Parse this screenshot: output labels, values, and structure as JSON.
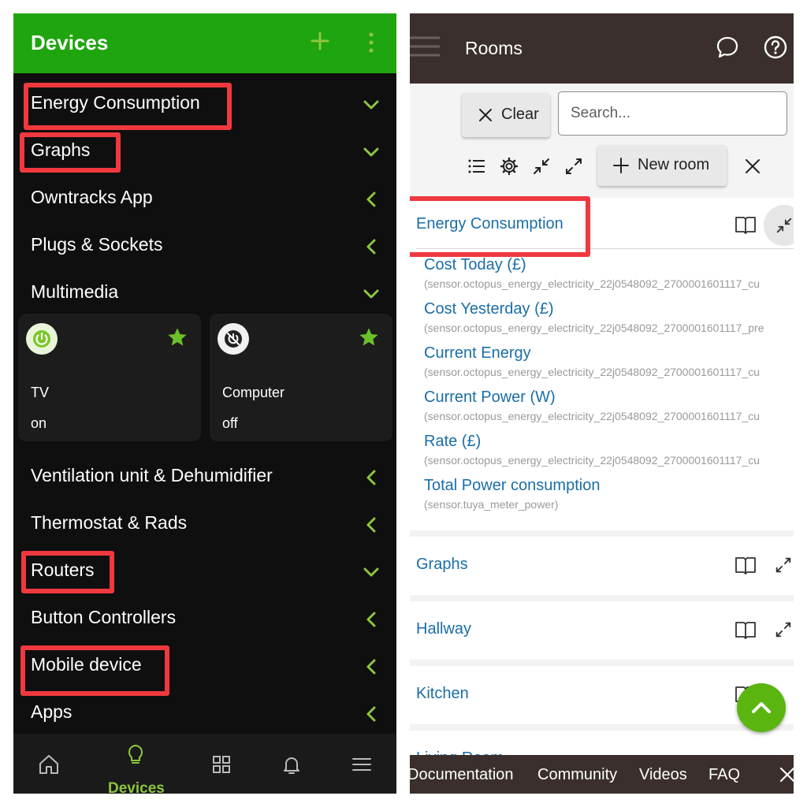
{
  "left": {
    "header": {
      "title": "Devices"
    },
    "rows": [
      {
        "label": "Energy Consumption",
        "chevron": "down"
      },
      {
        "label": "Graphs",
        "chevron": "down"
      },
      {
        "label": "Owntracks App",
        "chevron": "left"
      },
      {
        "label": "Plugs & Sockets",
        "chevron": "left"
      },
      {
        "label": "Multimedia",
        "chevron": "down"
      },
      {
        "label": "Ventilation unit & Dehumidifier",
        "chevron": "left"
      },
      {
        "label": "Thermostat & Rads",
        "chevron": "left"
      },
      {
        "label": "Routers",
        "chevron": "down"
      },
      {
        "label": "Button Controllers",
        "chevron": "left"
      },
      {
        "label": "Mobile device",
        "chevron": "left"
      },
      {
        "label": "Apps",
        "chevron": "left"
      }
    ],
    "cards": [
      {
        "name": "TV",
        "state": "on",
        "icon": "power-icon",
        "favorite": true
      },
      {
        "name": "Computer",
        "state": "off",
        "icon": "power-off-icon",
        "favorite": true
      }
    ],
    "nav": {
      "active_label": "Devices",
      "items": [
        "home-icon",
        "devices-bulb-icon",
        "grid-icon",
        "bell-icon",
        "menu-icon"
      ]
    }
  },
  "right": {
    "header": {
      "title": "Rooms"
    },
    "toolbar": {
      "clear_label": "Clear",
      "search_placeholder": "Search...",
      "new_room_label": "New room"
    },
    "open_room": {
      "name": "Energy Consumption",
      "entities": [
        {
          "name": "Cost Today (£)",
          "id": "(sensor.octopus_energy_electricity_22j0548092_2700001601117_cu"
        },
        {
          "name": "Cost Yesterday (£)",
          "id": "(sensor.octopus_energy_electricity_22j0548092_2700001601117_pre"
        },
        {
          "name": "Current Energy",
          "id": "(sensor.octopus_energy_electricity_22j0548092_2700001601117_cu"
        },
        {
          "name": "Current Power (W)",
          "id": "(sensor.octopus_energy_electricity_22j0548092_2700001601117_cu"
        },
        {
          "name": "Rate (£)",
          "id": "(sensor.octopus_energy_electricity_22j0548092_2700001601117_cu"
        },
        {
          "name": "Total Power consumption",
          "id": "(sensor.tuya_meter_power)"
        }
      ]
    },
    "rooms": [
      {
        "name": "Graphs"
      },
      {
        "name": "Hallway"
      },
      {
        "name": "Kitchen"
      },
      {
        "name": "Living Room"
      }
    ],
    "footer": {
      "links": [
        "Documentation",
        "Community",
        "Videos",
        "FAQ"
      ]
    }
  },
  "colors": {
    "green_header": "#1fa50f",
    "accent_green": "#8cc63f",
    "brown_header": "#3a2f2c",
    "link_blue": "#1a6ea8",
    "highlight_red": "#f0383f"
  }
}
